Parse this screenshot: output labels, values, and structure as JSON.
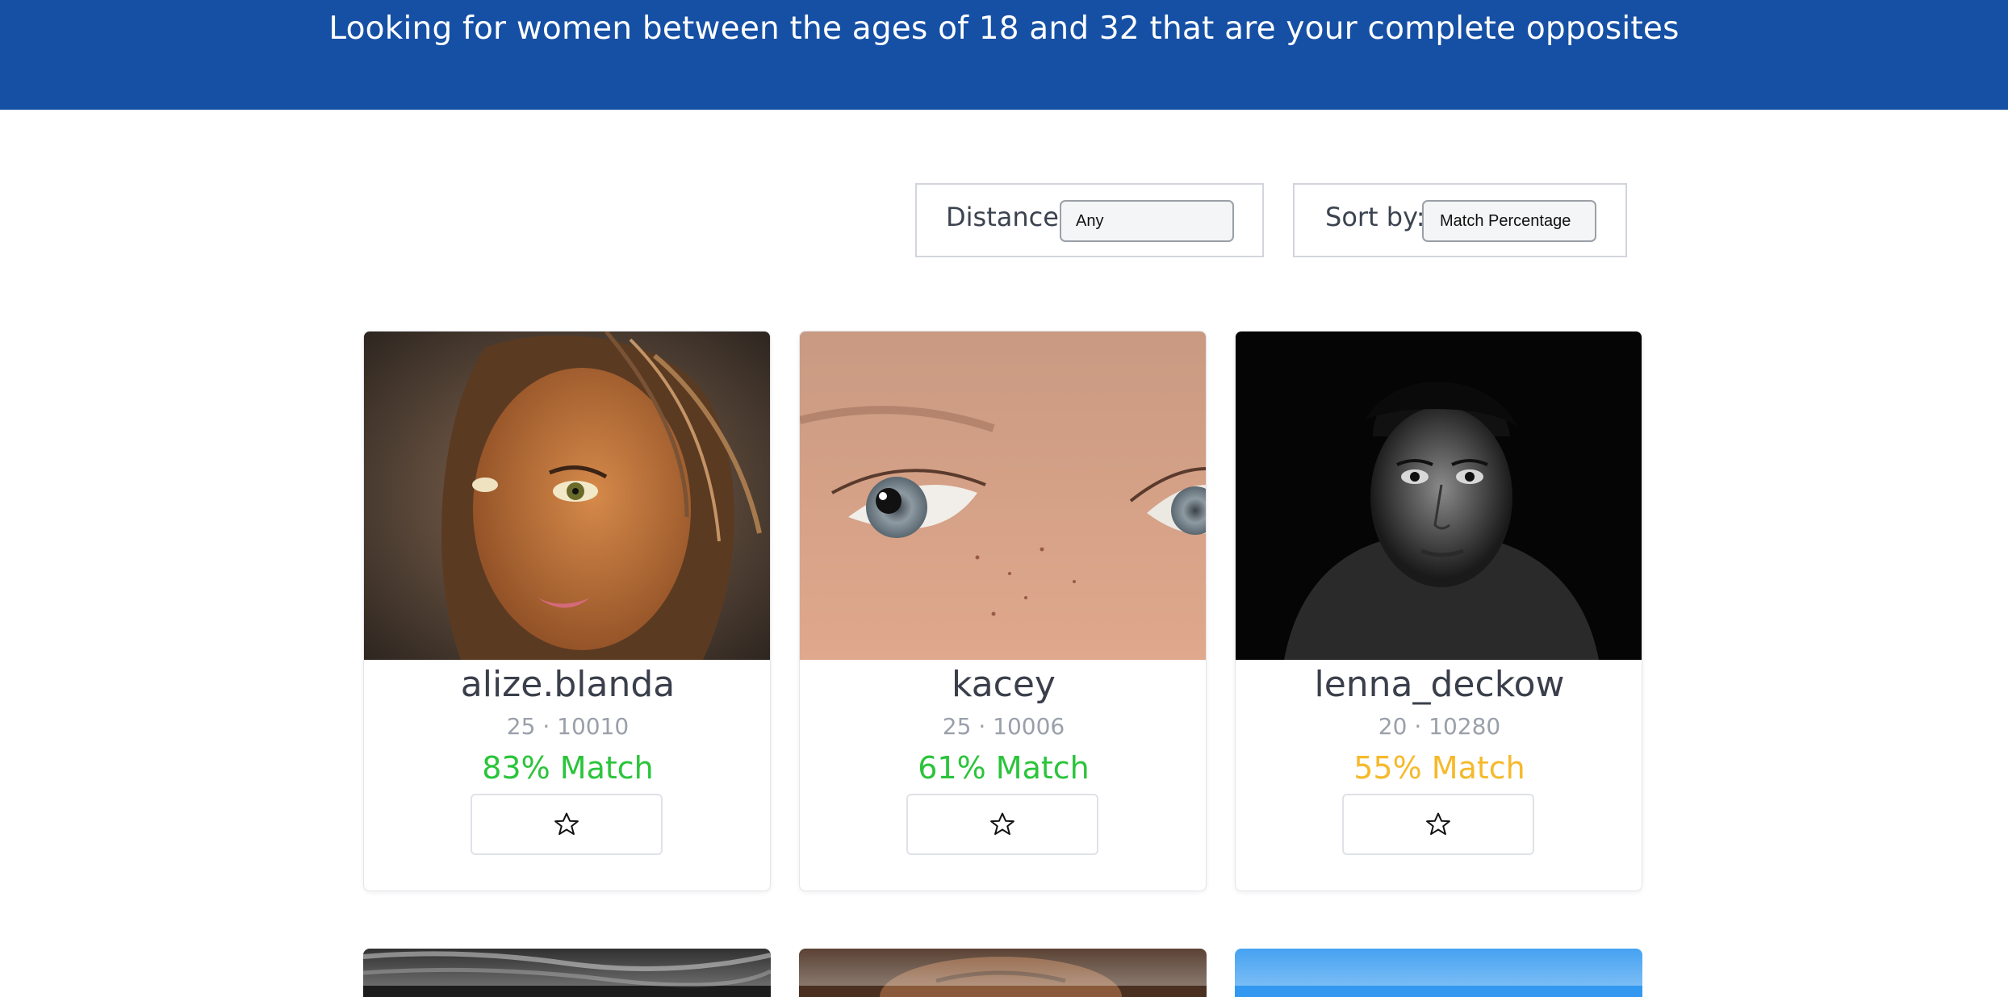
{
  "banner": {
    "title": "Looking for women between the ages of 18 and 32 that are your complete opposites"
  },
  "filters": {
    "distance": {
      "label": "Distance:",
      "value": "Any"
    },
    "sort": {
      "label": "Sort by:",
      "value": "Match Percentage"
    }
  },
  "profiles": [
    {
      "name": "alize.blanda",
      "meta": "25 · 10010",
      "match": "83% Match",
      "match_color": "#2bc43b",
      "photo": "doll face photo"
    },
    {
      "name": "kacey",
      "meta": "25 · 10006",
      "match": "61% Match",
      "match_color": "#2bc43b",
      "photo": "close-up eyes photo"
    },
    {
      "name": "lenna_deckow",
      "meta": "20 · 10280",
      "match": "55% Match",
      "match_color": "#f6b92b",
      "photo": "black and white portrait photo"
    }
  ],
  "favorite_icon": "star-outline-icon",
  "colors": {
    "banner": "#1650a5",
    "match_high": "#2bc43b",
    "match_mid": "#f6b92b",
    "partial_card_blue": "#3399f0"
  }
}
